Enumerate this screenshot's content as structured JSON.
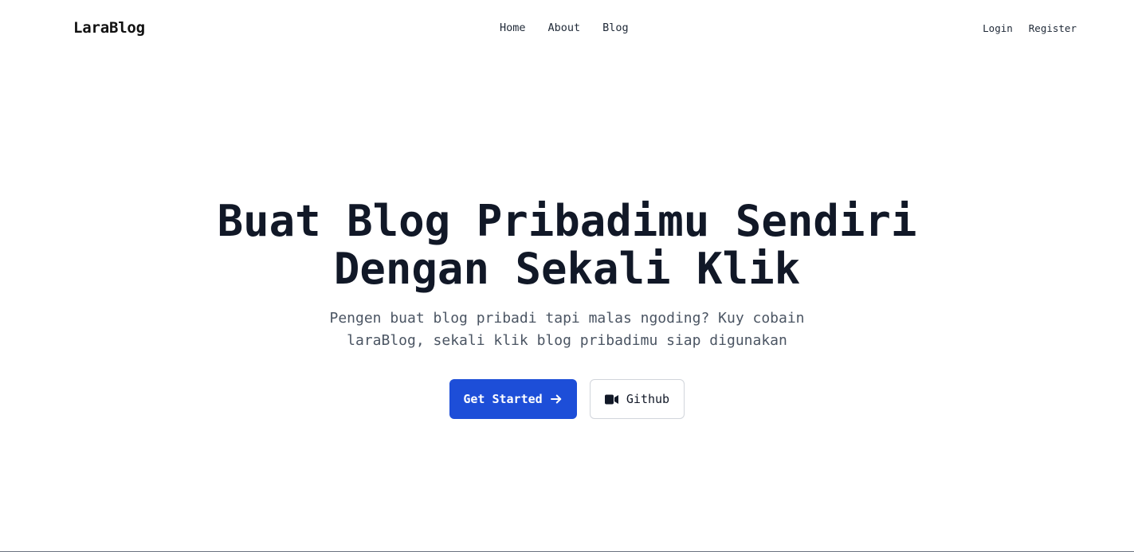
{
  "navbar": {
    "brand": "LaraBlog",
    "links": [
      {
        "label": "Home"
      },
      {
        "label": "About"
      },
      {
        "label": "Blog"
      }
    ],
    "auth": {
      "login": "Login",
      "register": "Register"
    }
  },
  "hero": {
    "title_line1": "Buat Blog Pribadimu Sendiri",
    "title_line2": "Dengan Sekali Klik",
    "subtitle_line1": "Pengen buat blog pribadi tapi malas ngoding? Kuy cobain",
    "subtitle_line2": "laraBlog, sekali klik blog pribadimu siap digunakan",
    "primary_button": {
      "label": "Get Started",
      "icon": "arrow-right-icon"
    },
    "secondary_button": {
      "label": "Github",
      "icon": "video-camera-icon"
    }
  },
  "colors": {
    "primary": "#1d4ed8",
    "heading": "#111827",
    "muted": "#4b5563",
    "border": "#d1d5db"
  }
}
